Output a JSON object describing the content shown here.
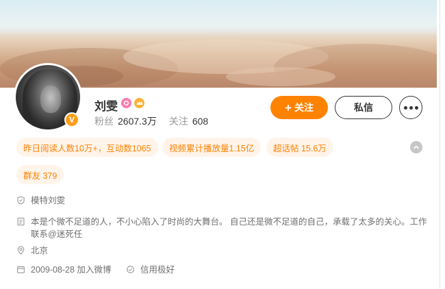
{
  "profile": {
    "name": "刘雯",
    "fans_label": "粉丝",
    "fans_value": "2607.3万",
    "follow_label": "关注",
    "follow_value": "608",
    "verified_badge": "V",
    "member_icon": "p",
    "vip_icon": "crown"
  },
  "actions": {
    "follow_plus": "+",
    "follow_label": "关注",
    "message_label": "私信",
    "more_icon": "more-dots"
  },
  "tags": [
    "昨日阅读人数10万+，互动数1065",
    "视频累计播放量1.15亿",
    "超话帖 15.6万",
    "群友 379"
  ],
  "info": {
    "occupation": "模特刘雯",
    "bio": "本是个微不足道的人，不小心陷入了时尚的大舞台。 自己还是微不足道的自己，承载了太多的关心。工作联系@迷死任",
    "location": "北京",
    "joined": "2009-08-28 加入微博",
    "credit": "信用极好"
  },
  "colors": {
    "accent": "#ff8200",
    "tag_bg": "#fff4ea",
    "text_muted": "#999999"
  }
}
